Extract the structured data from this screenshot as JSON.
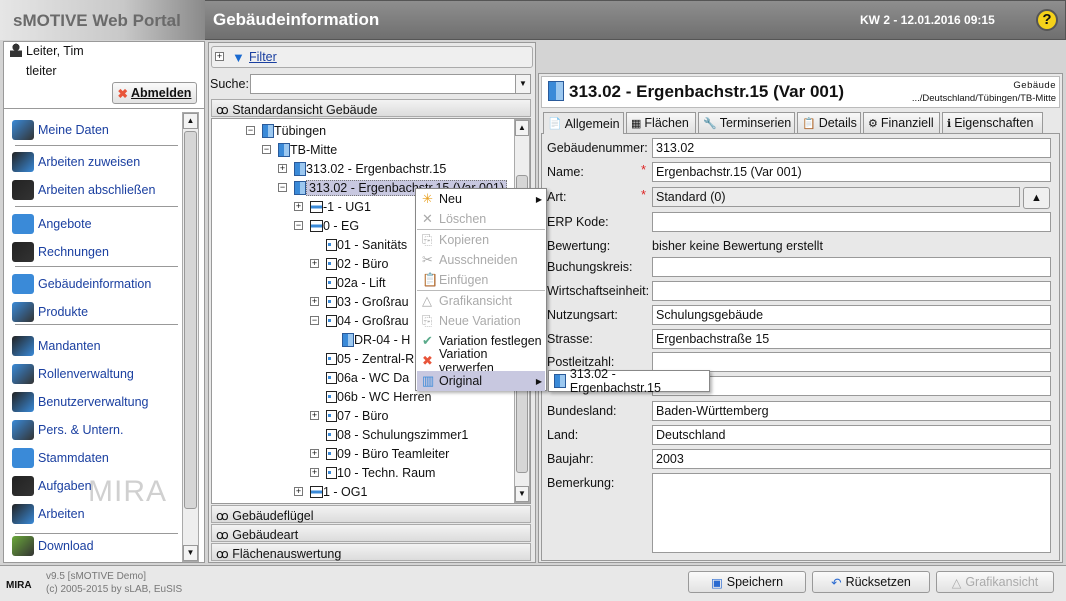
{
  "header": {
    "brand": "sMOTIVE Web Portal",
    "title": "Gebäudeinformation",
    "datetime": "KW 2 - 12.01.2016 09:15",
    "help": "?"
  },
  "user": {
    "name": "Leiter, Tim",
    "login": "tleiter",
    "logout": "Abmelden"
  },
  "sidebar": {
    "items": [
      {
        "label": "Meine Daten",
        "icon": "user-icon"
      },
      {
        "label": "Arbeiten zuweisen",
        "icon": "worker-icon"
      },
      {
        "label": "Arbeiten abschließen",
        "icon": "worker-done-icon"
      },
      {
        "label": "Angebote",
        "icon": "hand-icon"
      },
      {
        "label": "Rechnungen",
        "icon": "invoice-icon"
      },
      {
        "label": "Gebäudeinformation",
        "icon": "building-icon"
      },
      {
        "label": "Produkte",
        "icon": "product-icon"
      },
      {
        "label": "Mandanten",
        "icon": "tenants-icon"
      },
      {
        "label": "Rollenverwaltung",
        "icon": "masks-icon"
      },
      {
        "label": "Benutzerverwaltung",
        "icon": "users-icon"
      },
      {
        "label": "Pers. & Untern.",
        "icon": "person-company-icon"
      },
      {
        "label": "Stammdaten",
        "icon": "cabinet-icon"
      },
      {
        "label": "Aufgaben",
        "icon": "wrench-icon"
      },
      {
        "label": "Arbeiten",
        "icon": "gear-icon"
      },
      {
        "label": "Download",
        "icon": "cloud-download-icon"
      }
    ],
    "watermark": "MIRA"
  },
  "footer": {
    "version": "v9.5 [sMOTIVE Demo]",
    "copyright": "(c) 2005-2015 by sLAB, EuSIS",
    "logo": "MIRA",
    "save": "Speichern",
    "reset": "Rücksetzen",
    "graphic": "Grafikansicht"
  },
  "middle": {
    "filter": "Filter",
    "search_label": "Suche:",
    "search_value": "",
    "view": "Standardansicht Gebäude",
    "tree": [
      {
        "label": "Tübingen",
        "toggle": "−",
        "type": "city"
      },
      {
        "label": "TB-Mitte",
        "toggle": "−",
        "type": "site"
      },
      {
        "label": "313.02 - Ergenbachstr.15",
        "toggle": "+",
        "type": "building"
      },
      {
        "label": "313.02 - Ergenbachstr.15 (Var 001)",
        "toggle": "−",
        "type": "building",
        "selected": true
      },
      {
        "label": "-1 - UG1",
        "toggle": "+",
        "type": "floor"
      },
      {
        "label": "0 - EG",
        "toggle": "−",
        "type": "floor"
      },
      {
        "label": "01 - Sanitäts",
        "toggle": "",
        "type": "room"
      },
      {
        "label": "02 - Büro",
        "toggle": "+",
        "type": "room"
      },
      {
        "label": "02a - Lift",
        "toggle": "",
        "type": "room"
      },
      {
        "label": "03 - Großrau",
        "toggle": "+",
        "type": "room"
      },
      {
        "label": "04 - Großrau",
        "toggle": "−",
        "type": "room"
      },
      {
        "label": "DR-04 - H",
        "toggle": "",
        "type": "device"
      },
      {
        "label": "05 - Zentral-R",
        "toggle": "",
        "type": "room"
      },
      {
        "label": "06a - WC Da",
        "toggle": "",
        "type": "room"
      },
      {
        "label": "06b - WC Herren",
        "toggle": "",
        "type": "room"
      },
      {
        "label": "07 - Büro",
        "toggle": "+",
        "type": "room"
      },
      {
        "label": "08 - Schulungszimmer1",
        "toggle": "",
        "type": "room"
      },
      {
        "label": "09 - Büro Teamleiter",
        "toggle": "+",
        "type": "room"
      },
      {
        "label": "10 - Techn. Raum",
        "toggle": "+",
        "type": "room"
      },
      {
        "label": "1 - OG1",
        "toggle": "+",
        "type": "floor"
      }
    ],
    "accordion": [
      "Gebäudeflügel",
      "Gebäudeart",
      "Flächenauswertung"
    ]
  },
  "context_menu": {
    "items": [
      {
        "label": "Neu",
        "enabled": true,
        "submenu": true,
        "icon": "new-doc-icon"
      },
      {
        "label": "Löschen",
        "enabled": false,
        "icon": "delete-doc-icon"
      },
      {
        "label": "Kopieren",
        "enabled": false,
        "icon": "copy-icon"
      },
      {
        "label": "Ausschneiden",
        "enabled": false,
        "icon": "scissors-icon"
      },
      {
        "label": "Einfügen",
        "enabled": false,
        "icon": "paste-icon"
      },
      {
        "label": "Grafikansicht",
        "enabled": false,
        "icon": "graphic-icon"
      },
      {
        "label": "Neue Variation",
        "enabled": false,
        "icon": "variation-icon"
      },
      {
        "label": "Variation festlegen",
        "enabled": true,
        "icon": "check-icon"
      },
      {
        "label": "Variation verwerfen",
        "enabled": true,
        "icon": "x-icon"
      },
      {
        "label": "Original",
        "enabled": true,
        "submenu": true,
        "highlighted": true,
        "icon": "building-icon"
      }
    ],
    "submenu_item": "313.02 - Ergenbachstr.15"
  },
  "detail": {
    "title": "313.02 - Ergenbachstr.15 (Var 001)",
    "type": "Gebäude",
    "path": ".../Deutschland/Tübingen/TB-Mitte",
    "tabs": [
      "Allgemein",
      "Flächen",
      "Terminserien",
      "Details",
      "Finanziell",
      "Eigenschaften"
    ],
    "fields": [
      {
        "label": "Gebäudenummer:",
        "value": "313.02"
      },
      {
        "label": "Name:",
        "value": "Ergenbachstr.15 (Var 001)",
        "required": true
      },
      {
        "label": "Art:",
        "value": "Standard (0)",
        "required": true
      },
      {
        "label": "ERP Kode:",
        "value": ""
      },
      {
        "label": "Bewertung:",
        "value": "bisher keine Bewertung erstellt"
      },
      {
        "label": "Buchungskreis:",
        "value": ""
      },
      {
        "label": "Wirtschaftseinheit:",
        "value": ""
      },
      {
        "label": "Nutzungsart:",
        "value": "Schulungsgebäude"
      },
      {
        "label": "Strasse:",
        "value": "Ergenbachstraße 15"
      },
      {
        "label": "Postleitzahl:",
        "value": ""
      },
      {
        "label": "",
        "value": ""
      },
      {
        "label": "Bundesland:",
        "value": "Baden-Württemberg"
      },
      {
        "label": "Land:",
        "value": "Deutschland"
      },
      {
        "label": "Baujahr:",
        "value": "2003"
      },
      {
        "label": "Bemerkung:",
        "value": ""
      }
    ]
  },
  "colors": {
    "link": "#1a3fa0",
    "selection": "#c8c8e0",
    "accent": "#3a8ad8",
    "required": "#dd2222"
  }
}
